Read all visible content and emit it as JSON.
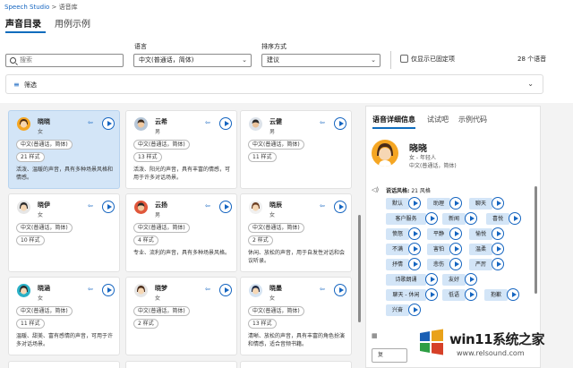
{
  "breadcrumb": {
    "root": "Speech Studio",
    "sep": ">",
    "current": "语音库"
  },
  "tabs": [
    {
      "label": "声音目录"
    },
    {
      "label": "用例示例"
    }
  ],
  "toolbar": {
    "search_placeholder": "搜索",
    "lang_label": "语言",
    "lang_value": "中文(普通话，简体)",
    "sort_label": "排序方式",
    "sort_value": "建议",
    "show_only": "仅显示已固定项",
    "count": "28 个语音",
    "filter": "筛选"
  },
  "voices": [
    {
      "name": "晓晓",
      "gender": "女",
      "lang": "中文(普通话，简体)",
      "styles": "21 样式",
      "desc": "活泼、温暖的声音，具有多种场景风格和情感。"
    },
    {
      "name": "云希",
      "gender": "男",
      "lang": "中文(普通话，简体)",
      "styles": "13 样式",
      "desc": "活泼、阳光的声音，具有丰富的情感，可用于许多对话场景。"
    },
    {
      "name": "云健",
      "gender": "男",
      "lang": "中文(普通话，简体)",
      "styles": "11 样式",
      "desc": ""
    },
    {
      "name": "晓伊",
      "gender": "女",
      "lang": "中文(普通话，简体)",
      "styles": "10 样式",
      "desc": ""
    },
    {
      "name": "云扬",
      "gender": "男",
      "lang": "中文(普通话，简体)",
      "styles": "4 样式",
      "desc": "专业、流利的声音，具有多种场景风格。"
    },
    {
      "name": "晓辰",
      "gender": "女",
      "lang": "中文(普通话，简体)",
      "styles": "2 样式",
      "desc": "休闲、放松的声音，用于自发性对话和会议听录。"
    },
    {
      "name": "晓涵",
      "gender": "女",
      "lang": "中文(普通话，简体)",
      "styles": "11 样式",
      "desc": "温暖、甜美、富有感情的声音，可用于许多对话场景。"
    },
    {
      "name": "晓梦",
      "gender": "女",
      "lang": "中文(普通话，简体)",
      "styles": "2 样式",
      "desc": ""
    },
    {
      "name": "晓墨",
      "gender": "女",
      "lang": "中文(普通话，简体)",
      "styles": "13 样式",
      "desc": "清晰、放松的声音，具有丰富的角色扮演和情感，适合音频书籍。"
    }
  ],
  "detail": {
    "tabs": [
      "语音详细信息",
      "试试吧",
      "示例代码"
    ],
    "name": "晓晓",
    "gender_age": "女 - 年轻人",
    "lang": "中文(普通话，简体)",
    "styles_label": "说话风格:",
    "styles_count": "21 风格",
    "styles": [
      "默认",
      "助理",
      "聊天",
      "客户服务",
      "新闻",
      "喜悦",
      "愤怒",
      "平静",
      "愉悦",
      "不满",
      "害怕",
      "温柔",
      "抒情",
      "悲伤",
      "严厉",
      "诗歌朗诵",
      "友好",
      "聊天 - 休闲",
      "低语",
      "抱歉",
      "兴奋"
    ],
    "bottom_btn": "复"
  },
  "watermark": {
    "title": "win11系统之家",
    "url": "www.relsound.com"
  },
  "colors": {
    "accent": "#0f6cbd",
    "selected": "#d3e5f7",
    "panel": "#f3f3f3"
  }
}
